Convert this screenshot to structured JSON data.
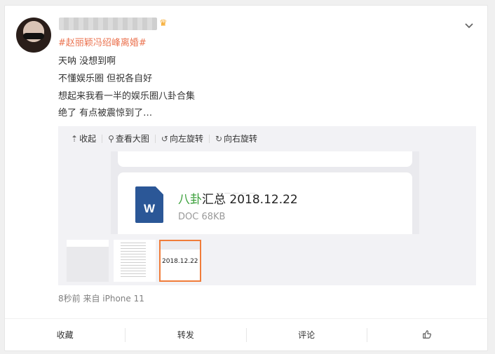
{
  "post": {
    "hashtag": "#赵丽颖冯绍峰离婚#",
    "lines": [
      "天呐 没想到啊",
      "不懂娱乐圈 但祝各自好",
      "想起来我看一半的娱乐圈八卦合集",
      "绝了 有点被震惊到了…"
    ],
    "timestamp": "8秒前  来自 iPhone 11"
  },
  "toolbar": {
    "collapse": "收起",
    "view_large": "查看大图",
    "rotate_left": "向左旋转",
    "rotate_right": "向右旋转"
  },
  "document": {
    "title_green": "八卦",
    "title_rest": "汇总 2018.12.22",
    "meta": "DOC 68KB",
    "icon_letter": "W"
  },
  "thumbnail3": {
    "text": "2018.12.22"
  },
  "actions": {
    "favorite": "收藏",
    "repost": "转发",
    "comment": "评论"
  },
  "icons": [
    "crown-icon",
    "chevron-down-icon",
    "collapse-icon",
    "zoom-icon",
    "rotate-left-icon",
    "rotate-right-icon",
    "thumbs-up-icon",
    "word-doc-icon"
  ],
  "colors": {
    "hashtag": "#eb7350",
    "accent_border": "#f07c39",
    "word_blue": "#2b5797",
    "green": "#3da13d"
  }
}
